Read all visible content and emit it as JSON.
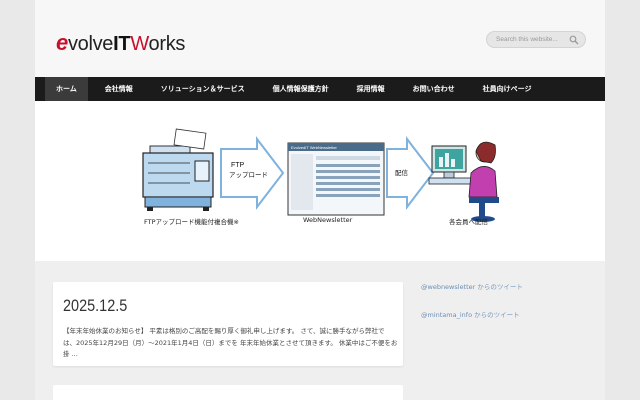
{
  "header": {
    "logo": {
      "e": "e",
      "volve": "volve",
      "it": "IT",
      "w": "W",
      "orks": "orks"
    },
    "search_placeholder": "Search this website..."
  },
  "nav": {
    "items": [
      "ホーム",
      "会社情報",
      "ソリューション＆サービス",
      "個人情報保護方針",
      "採用情報",
      "お問い合わせ",
      "社員向けページ"
    ],
    "active_index": 0
  },
  "banner": {
    "arrow1": [
      "FTP",
      "アップロード"
    ],
    "arrow2": "配信",
    "screen_title": "EvolvedIT WebNewsletter",
    "captions": [
      "FTPアップロード機能付複合機※",
      "WebNewsletter",
      "各会員へ配信"
    ]
  },
  "posts": [
    {
      "date": "2025.12.5",
      "excerpt_lines": [
        "【年末年始休業のお知らせ】 平素は格別のご高配を賜り厚く御礼申し上げます。 さて、誠に勝手ながら弊社で",
        "は、2025年12月29日（月）〜2021年1月4日（日）までを 年末年始休業とさせて頂きます。 休業中はご不便をお",
        "掛 ..."
      ]
    }
  ],
  "sidebar": {
    "tweets": [
      {
        "handle": "@webnewsletter",
        "suffix": " からのツイート"
      },
      {
        "handle": "@mintama_info",
        "suffix": " からのツイート"
      }
    ]
  },
  "colors": {
    "brand_red": "#c8102e",
    "nav_bg": "#1b1b1b",
    "link": "#6b8fb5"
  },
  "icons": [
    "search-icon",
    "printer-icon",
    "arrow-icon",
    "computer-user-icon"
  ]
}
